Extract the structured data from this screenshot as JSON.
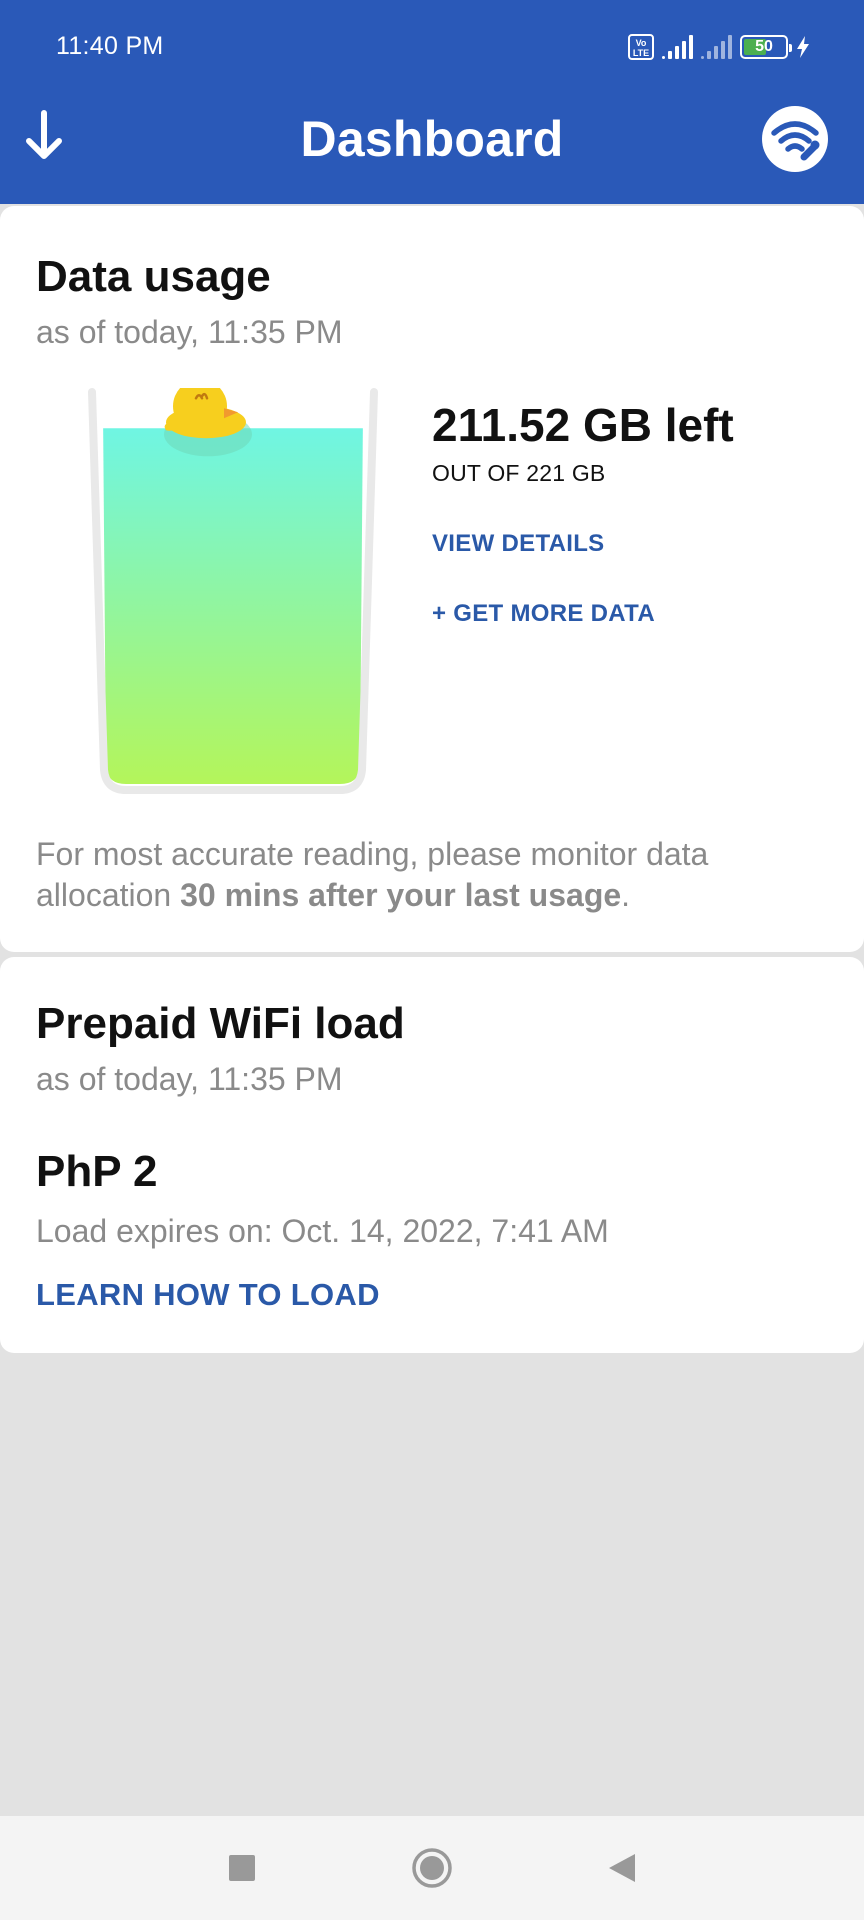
{
  "status_bar": {
    "time": "11:40 PM",
    "volte_top": "Vo",
    "volte_bottom": "LTE",
    "battery": "50"
  },
  "app_bar": {
    "title": "Dashboard",
    "back_icon": "arrow-down-icon",
    "right_icon": "wifi-wrench-icon"
  },
  "data_usage": {
    "title": "Data usage",
    "as_of": "as of today, 11:35 PM",
    "left": "211.52 GB left",
    "total": "OUT OF 221 GB",
    "remaining_fraction": 0.957,
    "view_details": "VIEW DETAILS",
    "get_more": "+ GET MORE DATA",
    "note_prefix": "For most accurate reading, please monitor data allocation ",
    "note_bold": "30 mins after your last usage",
    "note_suffix": "."
  },
  "prepaid": {
    "title": "Prepaid WiFi load",
    "as_of": "as of today, 11:35 PM",
    "amount": "PhP 2",
    "expires": "Load expires on: Oct. 14, 2022, 7:41 AM",
    "learn": "LEARN HOW TO LOAD"
  },
  "nav_bar": {
    "recent_icon": "square-icon",
    "home_icon": "circle-home-icon",
    "back_icon": "triangle-back-icon"
  },
  "colors": {
    "brand_blue": "#2a59b8",
    "link_blue": "#2a59a8",
    "water_top": "#6ff5e3",
    "water_bottom": "#b4f55a",
    "duck": "#f7cf1e"
  }
}
